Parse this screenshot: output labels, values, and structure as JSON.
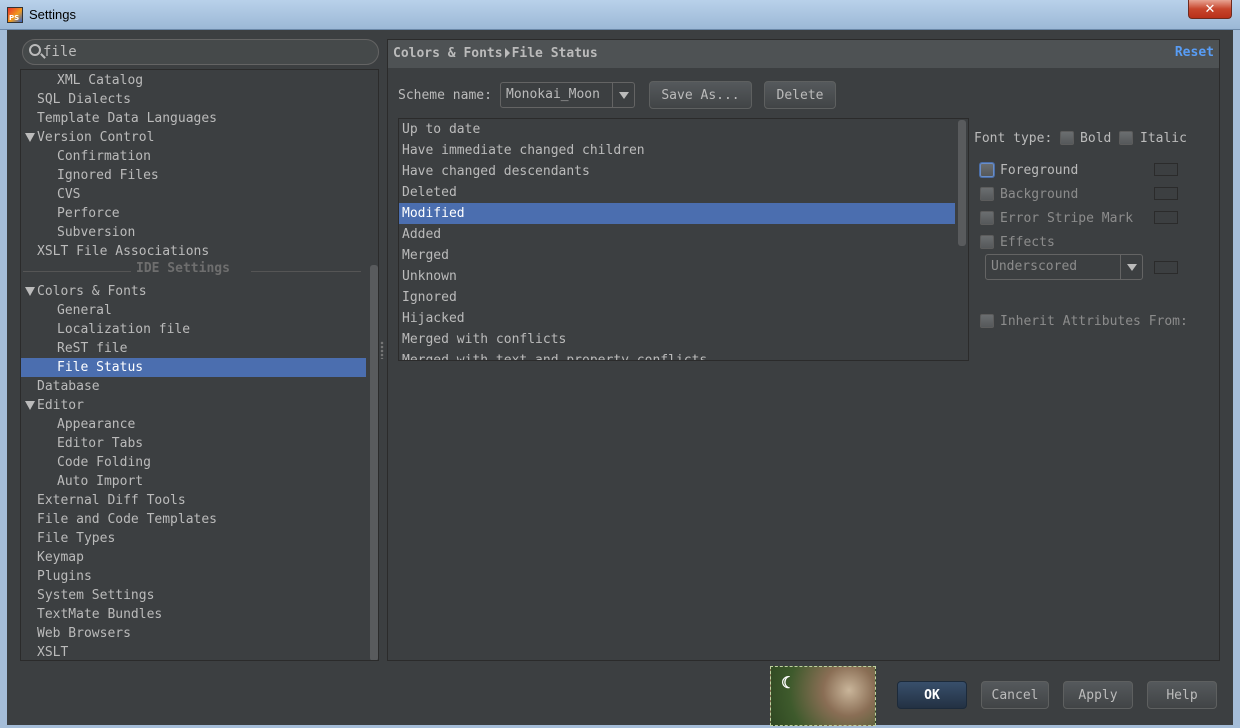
{
  "window": {
    "title": "Settings",
    "close_symbol": "✕"
  },
  "search": {
    "value": "file"
  },
  "tree": {
    "items": [
      {
        "label": "XML Catalog",
        "indent": 2
      },
      {
        "label": "SQL Dialects",
        "indent": 1
      },
      {
        "label": "Template Data Languages",
        "indent": 1
      },
      {
        "label": "Version Control",
        "indent": 1,
        "expanded": true
      },
      {
        "label": "Confirmation",
        "indent": 2
      },
      {
        "label": "Ignored Files",
        "indent": 2
      },
      {
        "label": "CVS",
        "indent": 2
      },
      {
        "label": "Perforce",
        "indent": 2
      },
      {
        "label": "Subversion",
        "indent": 2
      },
      {
        "label": "XSLT File Associations",
        "indent": 1
      }
    ],
    "section_label": "IDE Settings",
    "ide_items": [
      {
        "label": "Colors & Fonts",
        "indent": 1,
        "expanded": true
      },
      {
        "label": "General",
        "indent": 2
      },
      {
        "label": "Localization file",
        "indent": 2
      },
      {
        "label": "ReST file",
        "indent": 2
      },
      {
        "label": "File Status",
        "indent": 2,
        "selected": true
      },
      {
        "label": "Database",
        "indent": 1
      },
      {
        "label": "Editor",
        "indent": 1,
        "expanded": true
      },
      {
        "label": "Appearance",
        "indent": 2
      },
      {
        "label": "Editor Tabs",
        "indent": 2
      },
      {
        "label": "Code Folding",
        "indent": 2
      },
      {
        "label": "Auto Import",
        "indent": 2
      },
      {
        "label": "External Diff Tools",
        "indent": 1
      },
      {
        "label": "File and Code Templates",
        "indent": 1
      },
      {
        "label": "File Types",
        "indent": 1
      },
      {
        "label": "Keymap",
        "indent": 1
      },
      {
        "label": "Plugins",
        "indent": 1
      },
      {
        "label": "System Settings",
        "indent": 1
      },
      {
        "label": "TextMate Bundles",
        "indent": 1
      },
      {
        "label": "Web Browsers",
        "indent": 1
      },
      {
        "label": "XSLT",
        "indent": 1
      }
    ]
  },
  "header": {
    "crumb_parent": "Colors & Fonts",
    "crumb_current": "File Status",
    "reset_label": "Reset"
  },
  "scheme": {
    "label": "Scheme name:",
    "value": "Monokai_Moon",
    "save_as_label": "Save As...",
    "delete_label": "Delete"
  },
  "status_list": {
    "items": [
      "Up to date",
      "Have immediate changed children",
      "Have changed descendants",
      "Deleted",
      "Modified",
      "Added",
      "Merged",
      "Unknown",
      "Ignored",
      "Hijacked",
      "Merged with conflicts",
      "Merged with text and property conflicts"
    ],
    "selected_index": 4
  },
  "attributes": {
    "font_type_label": "Font type:",
    "bold_label": "Bold",
    "italic_label": "Italic",
    "foreground_label": "Foreground",
    "background_label": "Background",
    "error_stripe_label": "Error Stripe Mark",
    "effects_label": "Effects",
    "effects_value": "Underscored",
    "inherit_label": "Inherit Attributes From:"
  },
  "footer": {
    "ok_label": "OK",
    "cancel_label": "Cancel",
    "apply_label": "Apply",
    "help_label": "Help"
  },
  "colors": {
    "background": "#3c3f41",
    "selection": "#4b6eaf",
    "link": "#589df6",
    "text": "#bbbbbb"
  }
}
